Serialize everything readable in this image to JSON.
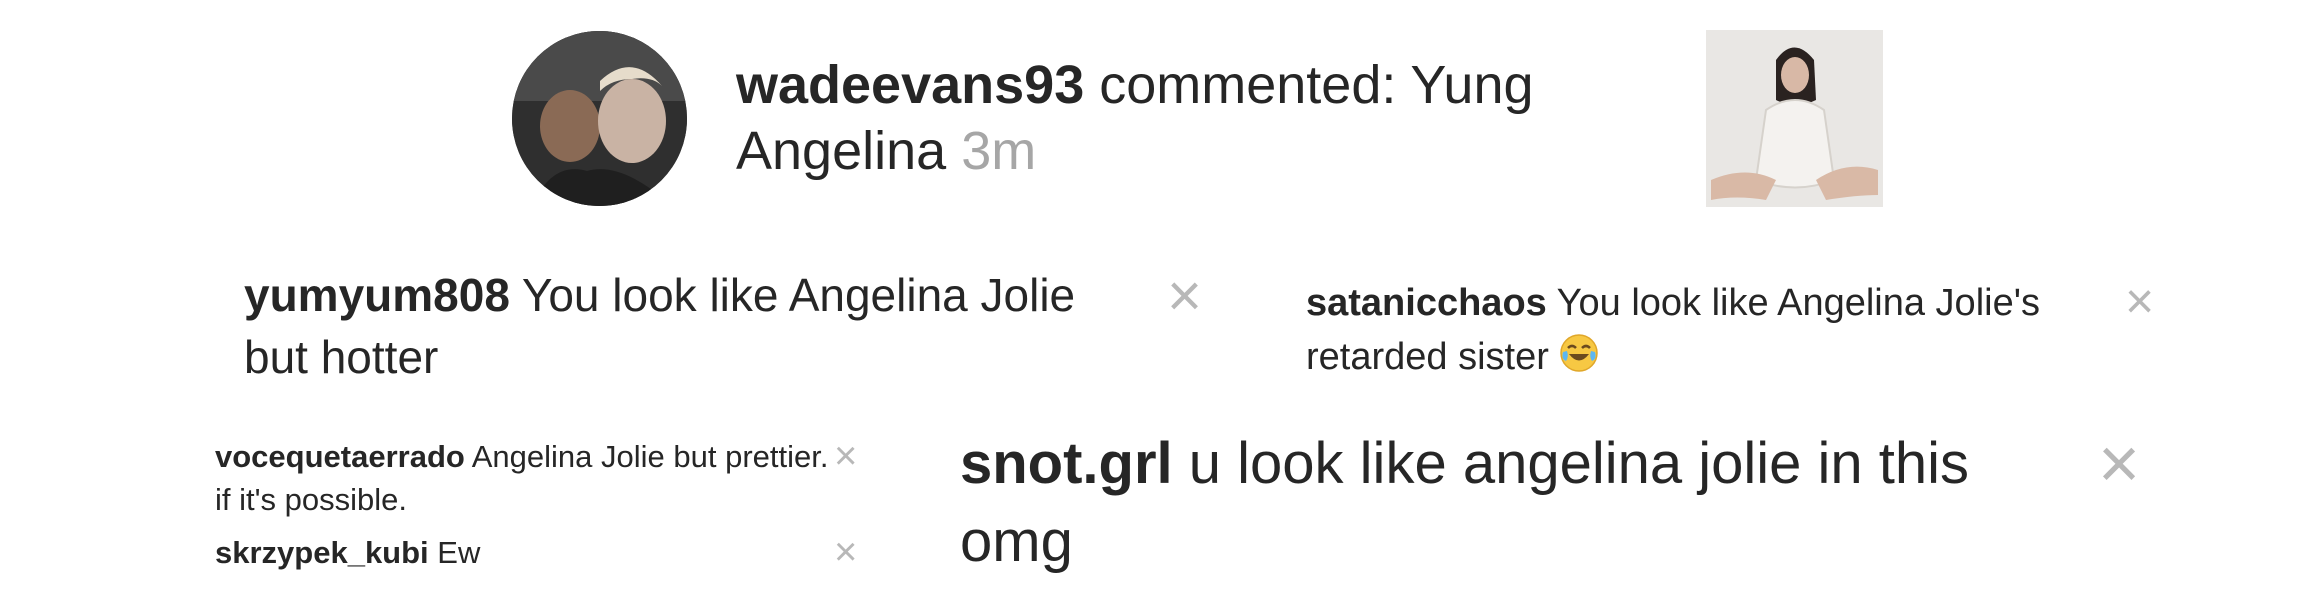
{
  "notification": {
    "username": "wadeevans93",
    "text": " commented: Yung Angelina ",
    "time": "3m",
    "avatar_icon": "profile-photo-icon",
    "thumbnail_icon": "post-thumbnail-icon"
  },
  "comments": [
    {
      "username": "yumyum808",
      "text": " You look like Angelina Jolie but hotter",
      "close_icon": "close-icon",
      "close": "×"
    },
    {
      "username": "satanicchaos",
      "text": " You look like Angelina Jolie's retarded sister ",
      "emoji": "tears-of-joy-icon",
      "close_icon": "close-icon",
      "close": "×"
    },
    {
      "username": "vocequetaerrado",
      "text": " Angelina Jolie but prettier. if it's possible.",
      "close_icon": "close-icon",
      "close": "×"
    },
    {
      "username": "skrzypek_kubi",
      "text": " Ew",
      "close_icon": "close-icon",
      "close": "×"
    },
    {
      "username": "snot.grl",
      "text": " u look like angelina jolie in this omg",
      "close_icon": "close-icon",
      "close": "×"
    }
  ]
}
